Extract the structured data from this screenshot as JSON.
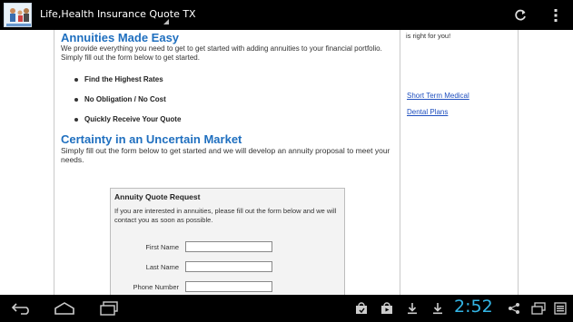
{
  "action_bar": {
    "title": "Life,Health Insurance Quote TX",
    "icons": [
      "app-logo-icon",
      "refresh-icon",
      "overflow-menu-icon"
    ]
  },
  "content": {
    "heading1": "Annuities Made Easy",
    "paragraph1": "We provide everything you need to get to get started with adding annuities to your financial portfolio. Simply fill out the form below to get started.",
    "bullets": [
      "Find the Highest Rates",
      "No Obligation / No Cost",
      "Quickly Receive Your Quote"
    ],
    "heading2": "Certainty in an Uncertain Market",
    "paragraph2": "Simply fill out the form below to get started and we will develop an annuity proposal to meet your needs.",
    "form": {
      "title": "Annuity Quote Request",
      "intro": "If you are interested in annuities, please fill out the form below and we will contact you as soon as possible.",
      "fields": [
        {
          "label": "First Name",
          "value": ""
        },
        {
          "label": "Last Name",
          "value": ""
        },
        {
          "label": "Phone Number",
          "value": ""
        }
      ]
    }
  },
  "sidebar": {
    "top_text": "is right for you!",
    "links": [
      "Short Term Medical",
      "Dental Plans"
    ]
  },
  "nav_bar": {
    "clock": "2:52",
    "icons": [
      "back-icon",
      "home-icon",
      "recent-apps-icon",
      "shopping-bag-icon",
      "play-store-icon",
      "download-icon",
      "download-icon-2",
      "share-icon",
      "window-icon",
      "menu-icon"
    ]
  },
  "colors": {
    "heading": "#1f6fbf",
    "link": "#1f4fbf",
    "clock": "#33b5e5",
    "bar_bg": "#000000"
  }
}
